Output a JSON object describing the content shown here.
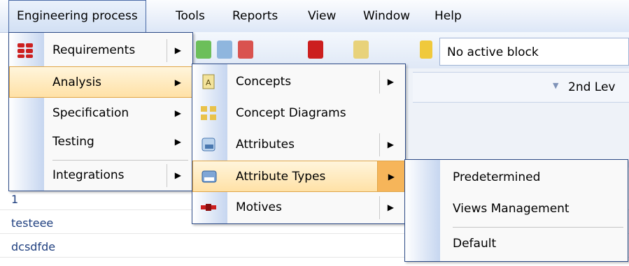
{
  "menubar": {
    "items": [
      {
        "label": "Engineering process"
      },
      {
        "label": "Tools"
      },
      {
        "label": "Reports"
      },
      {
        "label": "View"
      },
      {
        "label": "Window"
      },
      {
        "label": "Help"
      }
    ]
  },
  "toolbar": {
    "block_label": "No active block",
    "second_level_label": "2nd Lev"
  },
  "grid": {
    "rows": [
      "1",
      "testeee",
      "dcsdfde"
    ]
  },
  "menu_engineering": {
    "items": [
      {
        "label": "Requirements",
        "icon": "requirements-icon"
      },
      {
        "label": "Analysis"
      },
      {
        "label": "Specification"
      },
      {
        "label": "Testing"
      },
      {
        "label": "Integrations"
      }
    ]
  },
  "menu_analysis": {
    "items": [
      {
        "label": "Concepts",
        "icon": "concepts-icon"
      },
      {
        "label": "Concept Diagrams",
        "icon": "concept-diagrams-icon"
      },
      {
        "label": "Attributes",
        "icon": "attributes-icon"
      },
      {
        "label": "Attribute Types",
        "icon": "attribute-types-icon"
      },
      {
        "label": "Motives",
        "icon": "motives-icon"
      }
    ]
  },
  "menu_attribute_types": {
    "items": [
      {
        "label": "Predetermined"
      },
      {
        "label": "Views Management"
      },
      {
        "label": "Default"
      }
    ]
  },
  "colors": {
    "highlight": "#ffe1a6",
    "menu_border": "#2c4a86",
    "menubar": "#dde7f7"
  }
}
